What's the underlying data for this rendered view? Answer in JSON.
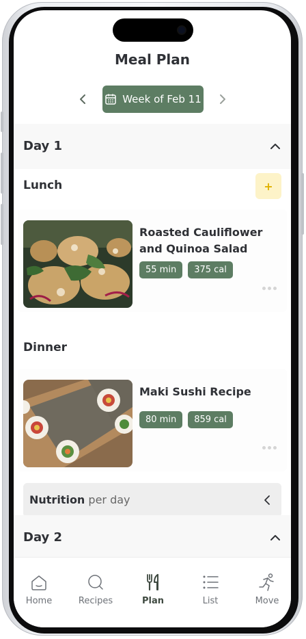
{
  "header": {
    "title": "Meal Plan"
  },
  "week": {
    "label": "Week of Feb 11"
  },
  "days": [
    {
      "title": "Day 1",
      "meals": [
        {
          "title": "Lunch",
          "add_label": "+",
          "recipe": {
            "name": "Roasted Cauliflower and Quinoa Salad",
            "time": "55 min",
            "calories": "375 cal"
          }
        },
        {
          "title": "Dinner",
          "recipe": {
            "name": "Maki Sushi Recipe",
            "time": "80 min",
            "calories": "859 cal"
          }
        }
      ]
    },
    {
      "title": "Day 2"
    }
  ],
  "nutrition": {
    "label": "Nutrition",
    "sub": "per day"
  },
  "tabs": [
    {
      "label": "Home",
      "icon": "home-icon"
    },
    {
      "label": "Recipes",
      "icon": "search-icon"
    },
    {
      "label": "Plan",
      "icon": "utensils-icon",
      "active": true
    },
    {
      "label": "List",
      "icon": "list-icon"
    },
    {
      "label": "Move",
      "icon": "running-icon"
    }
  ],
  "colors": {
    "accent": "#5d7d63",
    "add_bg": "#fdf3c8",
    "add_fg": "#e0b100"
  }
}
